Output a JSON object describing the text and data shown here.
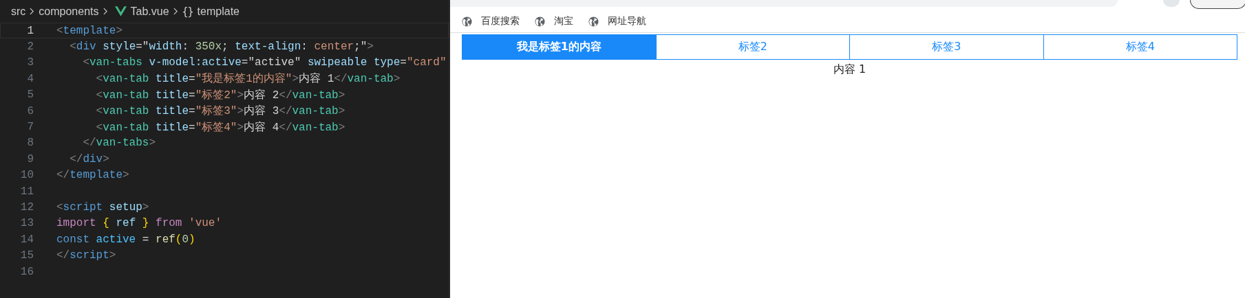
{
  "breadcrumb": {
    "parts": [
      "src",
      "components",
      "Tab.vue",
      "{}",
      "template"
    ]
  },
  "code_lines": [
    {
      "number": "1",
      "current": true,
      "tokens": [
        {
          "t": "<",
          "kind": "punct"
        },
        {
          "t": "template",
          "kind": "tag"
        },
        {
          "t": ">",
          "kind": "punct"
        }
      ]
    },
    {
      "number": "2",
      "current": false,
      "tokens": [
        {
          "t": "  <",
          "kind": "punct"
        },
        {
          "t": "div",
          "kind": "tag"
        },
        {
          "t": " style",
          "kind": "attr"
        },
        {
          "t": "=\"",
          "kind": "text"
        },
        {
          "t": "width",
          "kind": "attr"
        },
        {
          "t": ": ",
          "kind": "text"
        },
        {
          "t": "350x",
          "kind": "number"
        },
        {
          "t": "; ",
          "kind": "text"
        },
        {
          "t": "text-align",
          "kind": "attr"
        },
        {
          "t": ": ",
          "kind": "text"
        },
        {
          "t": "center",
          "kind": "string"
        },
        {
          "t": ";\"",
          "kind": "text"
        },
        {
          "t": ">",
          "kind": "punct"
        }
      ]
    },
    {
      "number": "3",
      "current": false,
      "tokens": [
        {
          "t": "    <",
          "kind": "punct"
        },
        {
          "t": "van-tabs",
          "kind": "component"
        },
        {
          "t": " v-model:active",
          "kind": "attr"
        },
        {
          "t": "=\"active\"",
          "kind": "text"
        },
        {
          "t": " swipeable type",
          "kind": "attr"
        },
        {
          "t": "=",
          "kind": "text"
        },
        {
          "t": "\"card\"",
          "kind": "string"
        }
      ]
    },
    {
      "number": "4",
      "current": false,
      "tokens": [
        {
          "t": "      <",
          "kind": "punct"
        },
        {
          "t": "van-tab",
          "kind": "component"
        },
        {
          "t": " title",
          "kind": "attr"
        },
        {
          "t": "=",
          "kind": "text"
        },
        {
          "t": "\"我是标签1的内容\"",
          "kind": "string"
        },
        {
          "t": ">",
          "kind": "punct"
        },
        {
          "t": "内容 1",
          "kind": "text"
        },
        {
          "t": "</",
          "kind": "punct"
        },
        {
          "t": "van-tab",
          "kind": "component"
        },
        {
          "t": ">",
          "kind": "punct"
        }
      ]
    },
    {
      "number": "5",
      "current": false,
      "tokens": [
        {
          "t": "      <",
          "kind": "punct"
        },
        {
          "t": "van-tab",
          "kind": "component"
        },
        {
          "t": " title",
          "kind": "attr"
        },
        {
          "t": "=",
          "kind": "text"
        },
        {
          "t": "\"标签2\"",
          "kind": "string"
        },
        {
          "t": ">",
          "kind": "punct"
        },
        {
          "t": "内容 2",
          "kind": "text"
        },
        {
          "t": "</",
          "kind": "punct"
        },
        {
          "t": "van-tab",
          "kind": "component"
        },
        {
          "t": ">",
          "kind": "punct"
        }
      ]
    },
    {
      "number": "6",
      "current": false,
      "tokens": [
        {
          "t": "      <",
          "kind": "punct"
        },
        {
          "t": "van-tab",
          "kind": "component"
        },
        {
          "t": " title",
          "kind": "attr"
        },
        {
          "t": "=",
          "kind": "text"
        },
        {
          "t": "\"标签3\"",
          "kind": "string"
        },
        {
          "t": ">",
          "kind": "punct"
        },
        {
          "t": "内容 3",
          "kind": "text"
        },
        {
          "t": "</",
          "kind": "punct"
        },
        {
          "t": "van-tab",
          "kind": "component"
        },
        {
          "t": ">",
          "kind": "punct"
        }
      ]
    },
    {
      "number": "7",
      "current": false,
      "tokens": [
        {
          "t": "      <",
          "kind": "punct"
        },
        {
          "t": "van-tab",
          "kind": "component"
        },
        {
          "t": " title",
          "kind": "attr"
        },
        {
          "t": "=",
          "kind": "text"
        },
        {
          "t": "\"标签4\"",
          "kind": "string"
        },
        {
          "t": ">",
          "kind": "punct"
        },
        {
          "t": "内容 4",
          "kind": "text"
        },
        {
          "t": "</",
          "kind": "punct"
        },
        {
          "t": "van-tab",
          "kind": "component"
        },
        {
          "t": ">",
          "kind": "punct"
        }
      ]
    },
    {
      "number": "8",
      "current": false,
      "tokens": [
        {
          "t": "    </",
          "kind": "punct"
        },
        {
          "t": "van-tabs",
          "kind": "component"
        },
        {
          "t": ">",
          "kind": "punct"
        }
      ]
    },
    {
      "number": "9",
      "current": false,
      "tokens": [
        {
          "t": "  </",
          "kind": "punct"
        },
        {
          "t": "div",
          "kind": "tag"
        },
        {
          "t": ">",
          "kind": "punct"
        }
      ]
    },
    {
      "number": "10",
      "current": false,
      "tokens": [
        {
          "t": "</",
          "kind": "punct"
        },
        {
          "t": "template",
          "kind": "tag"
        },
        {
          "t": ">",
          "kind": "punct"
        }
      ]
    },
    {
      "number": "11",
      "current": false
    },
    {
      "number": "12",
      "current": false,
      "tokens": [
        {
          "t": "<",
          "kind": "punct"
        },
        {
          "t": "script",
          "kind": "tag"
        },
        {
          "t": " setup",
          "kind": "attr"
        },
        {
          "t": ">",
          "kind": "punct"
        }
      ]
    },
    {
      "number": "13",
      "current": false,
      "tokens": [
        {
          "t": "import ",
          "kind": "keyword"
        },
        {
          "t": "{",
          "kind": "brace"
        },
        {
          "t": " ref ",
          "kind": "attr"
        },
        {
          "t": "}",
          "kind": "brace"
        },
        {
          "t": " from ",
          "kind": "keyword"
        },
        {
          "t": "'vue'",
          "kind": "string"
        }
      ]
    },
    {
      "number": "14",
      "current": false,
      "tokens": [
        {
          "t": "const ",
          "kind": "tag"
        },
        {
          "t": "active",
          "kind": "variable"
        },
        {
          "t": " = ",
          "kind": "text"
        },
        {
          "t": "ref",
          "kind": "function"
        },
        {
          "t": "(",
          "kind": "brace"
        },
        {
          "t": "0",
          "kind": "number"
        },
        {
          "t": ")",
          "kind": "brace"
        }
      ]
    },
    {
      "number": "15",
      "current": false,
      "tokens": [
        {
          "t": "</",
          "kind": "punct"
        },
        {
          "t": "script",
          "kind": "tag"
        },
        {
          "t": ">",
          "kind": "punct"
        }
      ]
    },
    {
      "number": "16",
      "current": false
    }
  ],
  "browser": {
    "bookmarks": [
      "百度搜索",
      "淘宝",
      "网址导航"
    ],
    "tabs": [
      {
        "label": "我是标签1的内容",
        "selected": true
      },
      {
        "label": "标签2",
        "selected": false
      },
      {
        "label": "标签3",
        "selected": false
      },
      {
        "label": "标签4",
        "selected": false
      }
    ],
    "content": "内容 1"
  }
}
